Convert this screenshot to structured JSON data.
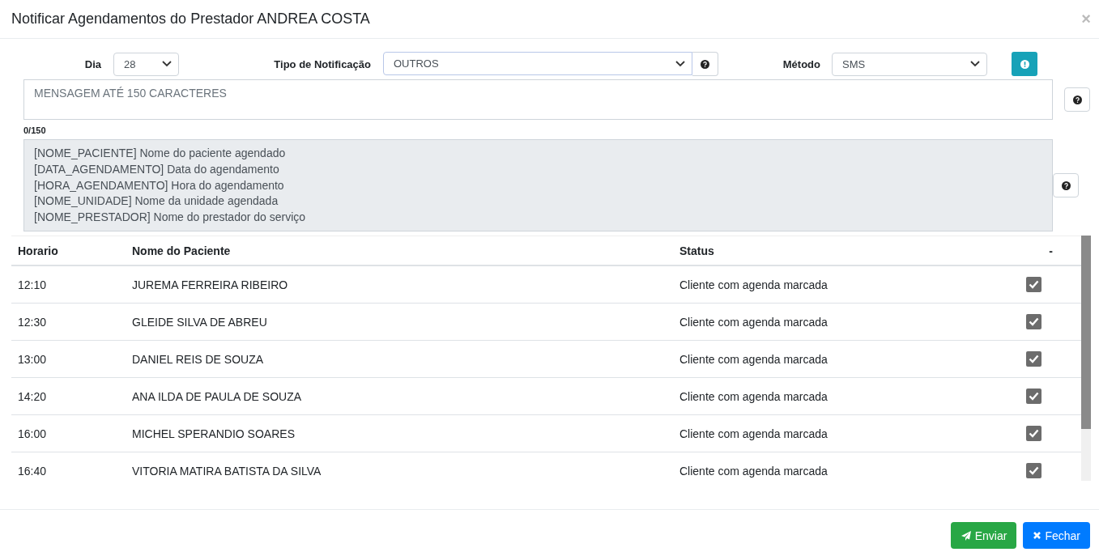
{
  "window": {
    "title": "Notificar Agendamentos do Prestador ANDREA COSTA",
    "close": "×"
  },
  "filters": {
    "day": {
      "label": "Dia",
      "value": "28"
    },
    "type": {
      "label": "Tipo de Notificação",
      "value": "OUTROS"
    },
    "method": {
      "label": "Método",
      "value": "SMS"
    }
  },
  "message": {
    "placeholder": "MENSAGEM ATÉ 150 CARACTERES",
    "counter": "0/150"
  },
  "variables": [
    "[NOME_PACIENTE] Nome do paciente agendado",
    "[DATA_AGENDAMENTO] Data do agendamento",
    "[HORA_AGENDAMENTO] Hora do agendamento",
    "[NOME_UNIDADE] Nome da unidade agendada",
    "[NOME_PRESTADOR] Nome do prestador do serviço"
  ],
  "table": {
    "columns": [
      "Horario",
      "Nome do Paciente",
      "Status",
      "-"
    ],
    "rows": [
      {
        "time": "12:10",
        "name": "JUREMA FERREIRA RIBEIRO",
        "status": "Cliente com agenda marcada",
        "checked": true
      },
      {
        "time": "12:30",
        "name": "GLEIDE SILVA DE ABREU",
        "status": "Cliente com agenda marcada",
        "checked": true
      },
      {
        "time": "13:00",
        "name": "DANIEL REIS DE SOUZA",
        "status": "Cliente com agenda marcada",
        "checked": true
      },
      {
        "time": "14:20",
        "name": "ANA ILDA DE PAULA DE SOUZA",
        "status": "Cliente com agenda marcada",
        "checked": true
      },
      {
        "time": "16:00",
        "name": "MICHEL SPERANDIO SOARES",
        "status": "Cliente com agenda marcada",
        "checked": true
      },
      {
        "time": "16:40",
        "name": "VITORIA MATIRA BATISTA DA SILVA",
        "status": "Cliente com agenda marcada",
        "checked": true
      }
    ]
  },
  "buttons": [
    {
      "kind": "send",
      "label": "Enviar"
    },
    {
      "kind": "close",
      "label": "Fechar"
    }
  ]
}
